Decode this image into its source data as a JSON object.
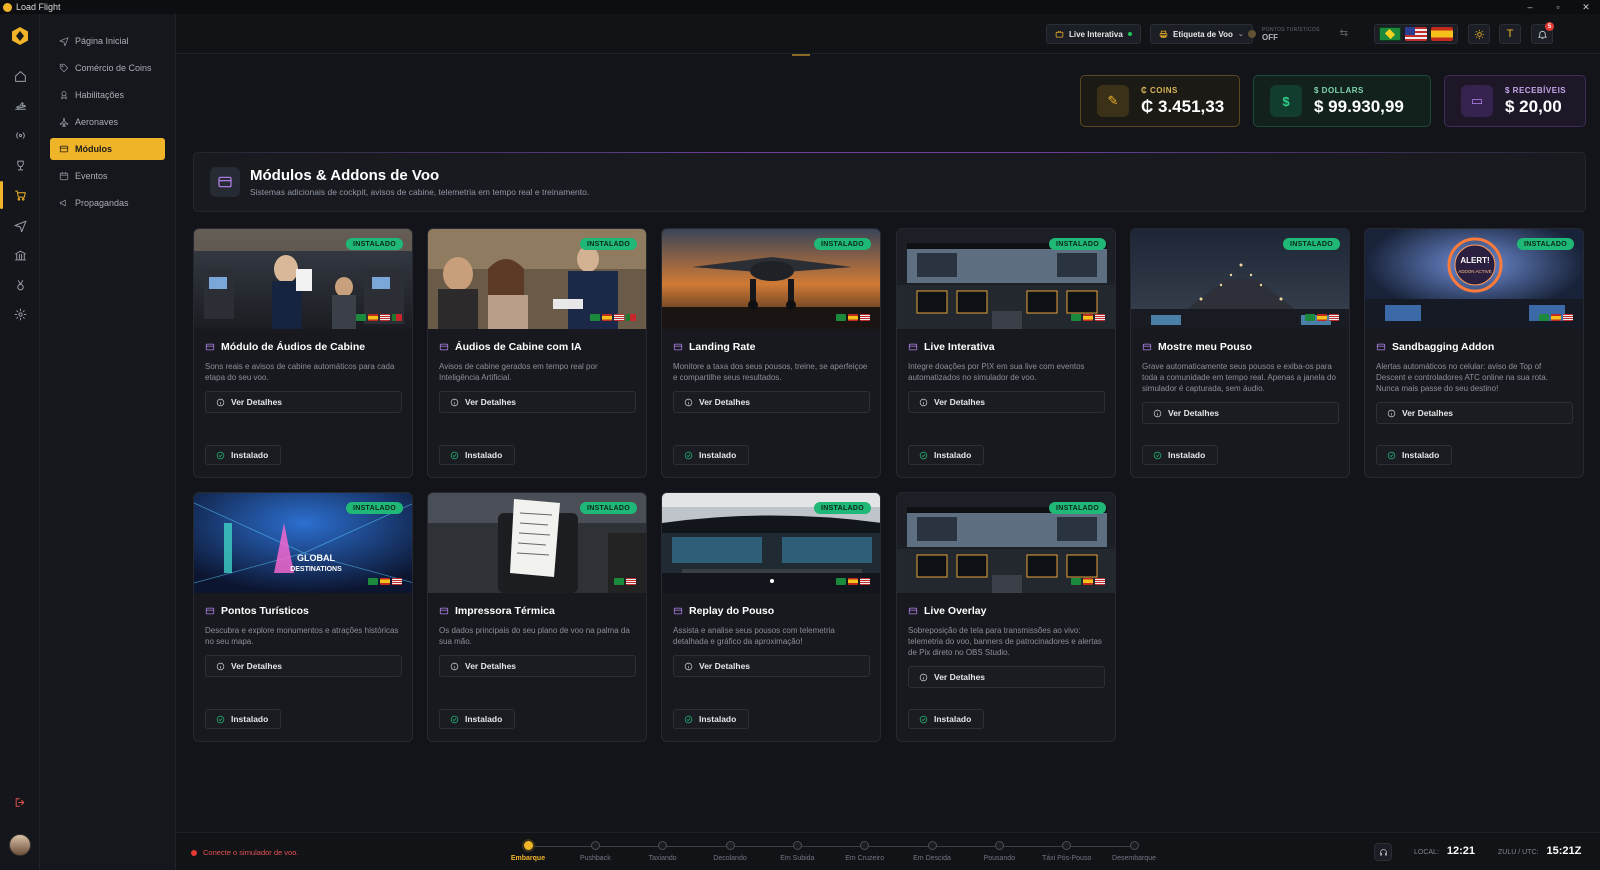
{
  "app": {
    "title": "Load Flight"
  },
  "window_controls": {
    "minimize": "–",
    "maximize": "▫",
    "close": "✕"
  },
  "sidebar": {
    "items": [
      {
        "label": "Página Inicial",
        "icon": "plane-icon"
      },
      {
        "label": "Comércio de Coins",
        "icon": "tag-icon"
      },
      {
        "label": "Habilitações",
        "icon": "badge-icon"
      },
      {
        "label": "Aeronaves",
        "icon": "plane-icon"
      },
      {
        "label": "Módulos",
        "icon": "box-icon",
        "active": true
      },
      {
        "label": "Eventos",
        "icon": "calendar-icon"
      },
      {
        "label": "Propagandas",
        "icon": "megaphone-icon"
      }
    ]
  },
  "topbar": {
    "live_label": "Live Interativa",
    "etiqueta_label": "Etiqueta de Voo",
    "pontos_label": "PONTOS TURÍSTICOS",
    "pontos_value": "OFF",
    "notification_count": "5",
    "t_label": "T"
  },
  "balances": {
    "coins": {
      "title": "₵ COINS",
      "value": "₵ 3.451,33"
    },
    "dollars": {
      "title": "$ DOLLARS",
      "value": "$ 99.930,99"
    },
    "receivables": {
      "title": "$ RECEBÍVEIS",
      "value": "$ 20,00"
    }
  },
  "page": {
    "title": "Módulos & Addons de Voo",
    "subtitle": "Sistemas adicionais de cockpit, avisos de cabine, telemetria em tempo real e treinamento."
  },
  "labels": {
    "installed_badge": "INSTALADO",
    "details_button": "Ver Detalhes",
    "installed_button": "Instalado"
  },
  "modules": [
    {
      "title": "Módulo de Áudios de Cabine",
      "desc": "Sons reais e avisos de cabine automáticos para cada etapa do seu voo."
    },
    {
      "title": "Áudios de Cabine com IA",
      "desc": "Avisos de cabine gerados em tempo real por Inteligência Artificial."
    },
    {
      "title": "Landing Rate",
      "desc": "Monitore a taxa dos seus pousos, treine, se aperfeiçoe e compartilhe seus resultados."
    },
    {
      "title": "Live Interativa",
      "desc": "Integre doações por PIX em sua live com eventos automatizados no simulador de voo."
    },
    {
      "title": "Mostre meu Pouso",
      "desc": "Grave automaticamente seus pousos e exiba-os para toda a comunidade em tempo real. Apenas a janela do simulador é capturada, sem áudio."
    },
    {
      "title": "Sandbagging Addon",
      "desc": "Alertas automáticos no celular: aviso de Top of Descent e controladores ATC online na sua rota. Nunca mais passe do seu destino!"
    },
    {
      "title": "Pontos Turísticos",
      "desc": "Descubra e explore monumentos e atrações históricas no seu mapa."
    },
    {
      "title": "Impressora Térmica",
      "desc": "Os dados principais do seu plano de voo na palma da sua mão."
    },
    {
      "title": "Replay do Pouso",
      "desc": "Assista e analise seus pousos com telemetria detalhada e gráfico da aproximação!"
    },
    {
      "title": "Live Overlay",
      "desc": "Sobreposição de tela para transmissões ao vivo: telemetria do voo, banners de patrocinadores e alertas de Pix direto no OBS Studio."
    }
  ],
  "thumb_texts": {
    "alert_title": "ALERT!",
    "alert_sub": "ADDON ACTIVE",
    "global_title": "GLOBAL",
    "global_sub": "DESTINATIONS"
  },
  "footer": {
    "connection": "Conecte o simulador de voo.",
    "phases": [
      "Embarque",
      "Pushback",
      "Taxiando",
      "Decolando",
      "Em Subida",
      "Em Cruzeiro",
      "Em Descida",
      "Pousando",
      "Táxi Pós-Pouso",
      "Desembarque"
    ],
    "active_phase": "Embarque",
    "local_label": "LOCAL:",
    "local_time": "12:21",
    "zulu_label": "ZULU / UTC:",
    "zulu_time": "15:21Z"
  },
  "colors": {
    "accent": "#f0b429",
    "installed_green": "#1fb877",
    "purple": "#b585f0",
    "error_red": "#e53935"
  }
}
